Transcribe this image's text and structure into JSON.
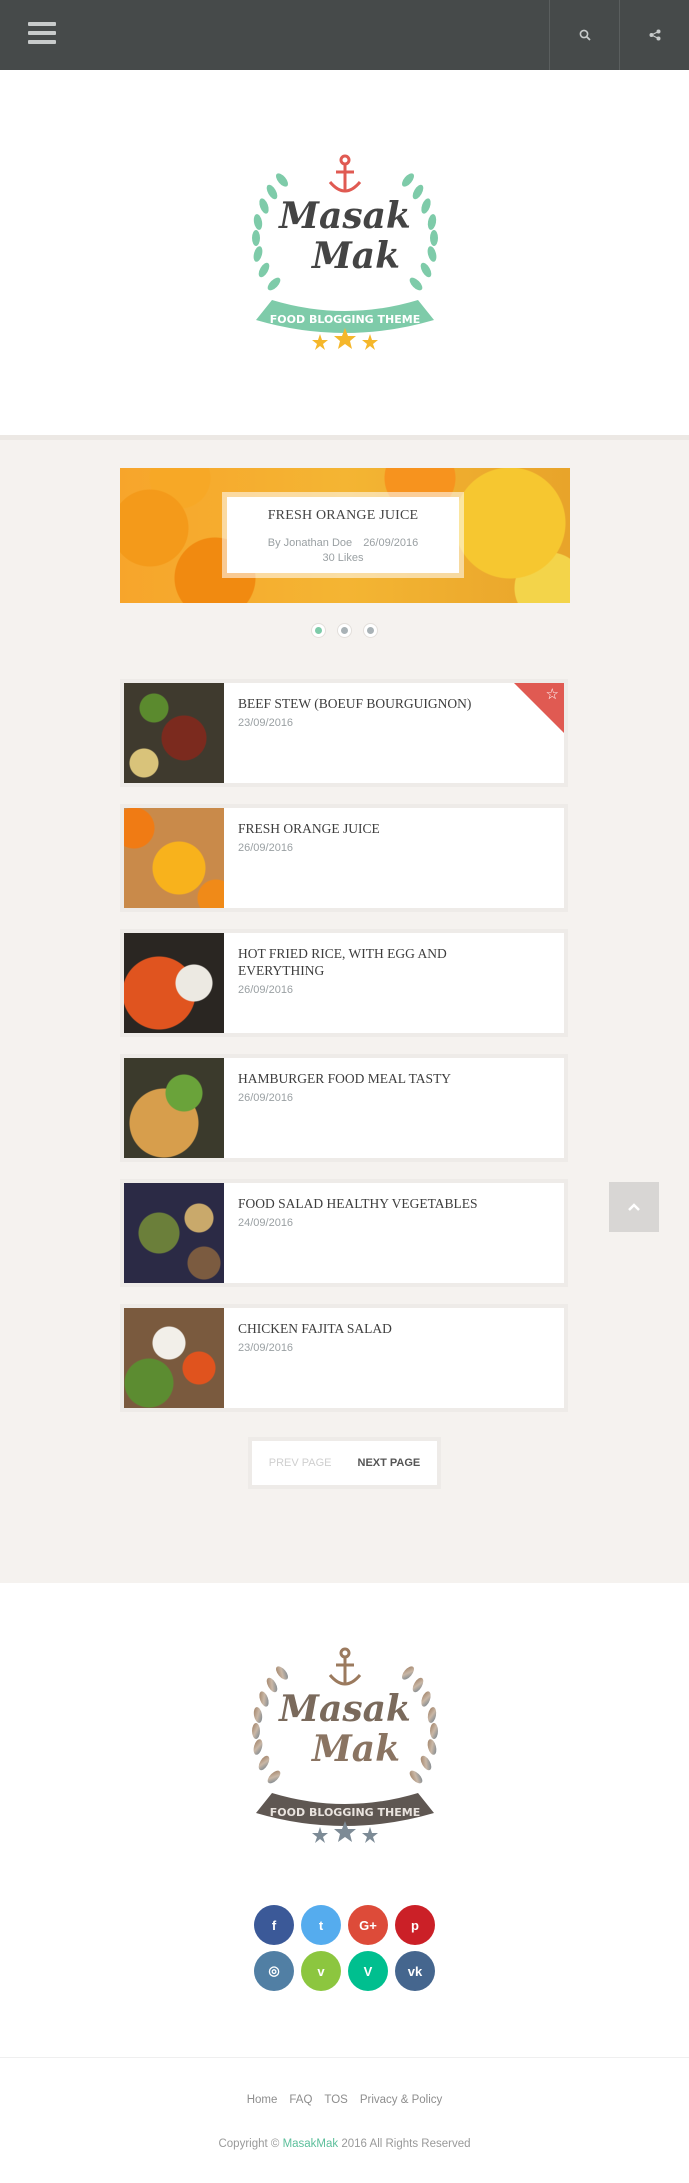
{
  "topbar": {
    "menu_icon": "hamburger-menu-icon",
    "search_icon": "search-icon",
    "share_icon": "share-icon"
  },
  "logo": {
    "line1": "Masak",
    "line2": "Mak",
    "ribbon": "FOOD BLOGGING THEME"
  },
  "slider": {
    "title": "FRESH ORANGE JUICE",
    "author": "By Jonathan Doe",
    "date": "26/09/2016",
    "likes": "30 Likes",
    "slide_count": 3,
    "active_slide": 1
  },
  "posts": [
    {
      "title": "BEEF STEW (BOEUF BOURGUIGNON)",
      "date": "23/09/2016",
      "featured": true
    },
    {
      "title": "FRESH ORANGE JUICE",
      "date": "26/09/2016",
      "featured": false
    },
    {
      "title": "HOT FRIED RICE, WITH EGG AND EVERYTHING",
      "date": "26/09/2016",
      "featured": false
    },
    {
      "title": "HAMBURGER FOOD MEAL TASTY",
      "date": "26/09/2016",
      "featured": false
    },
    {
      "title": "FOOD SALAD HEALTHY VEGETABLES",
      "date": "24/09/2016",
      "featured": false
    },
    {
      "title": "CHICKEN FAJITA SALAD",
      "date": "23/09/2016",
      "featured": false
    }
  ],
  "pager": {
    "prev": "PREV PAGE",
    "next": "NEXT PAGE"
  },
  "socials": [
    {
      "name": "facebook",
      "glyph": "f",
      "color": "#3b5998"
    },
    {
      "name": "twitter",
      "glyph": "t",
      "color": "#55acee"
    },
    {
      "name": "google-plus",
      "glyph": "G+",
      "color": "#dd4b39"
    },
    {
      "name": "pinterest",
      "glyph": "p",
      "color": "#cb2027"
    },
    {
      "name": "instagram",
      "glyph": "◎",
      "color": "#517fa4"
    },
    {
      "name": "vimeo",
      "glyph": "v",
      "color": "#8cc63f"
    },
    {
      "name": "vine",
      "glyph": "V",
      "color": "#00bf8f"
    },
    {
      "name": "vk",
      "glyph": "vk",
      "color": "#45668e"
    }
  ],
  "footer": {
    "links": [
      "Home",
      "FAQ",
      "TOS",
      "Privacy & Policy"
    ],
    "copyright_prefix": "Copyright ©",
    "brand": "MasakMak",
    "copyright_suffix": "2016 All Rights Reserved"
  },
  "colors": {
    "accent": "#7ecba9",
    "topbar": "#464a4a",
    "ribbon": "#e05a52",
    "background": "#f5f2ef"
  }
}
